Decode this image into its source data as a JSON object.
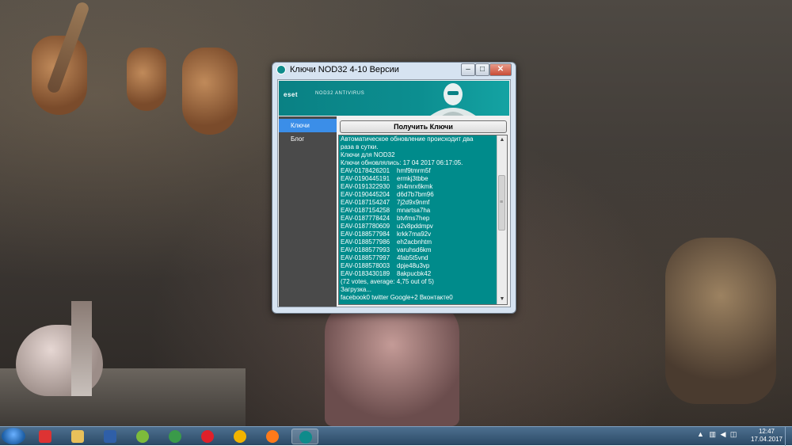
{
  "window": {
    "title": "Ключи NOD32 4-10 Версии",
    "controls": {
      "minimize": "–",
      "maximize": "□",
      "close": "✕"
    }
  },
  "banner": {
    "logo": "eset",
    "product": "NOD32 ANTIVIRUS"
  },
  "nav": {
    "items": [
      {
        "label": "Ключи",
        "active": true
      },
      {
        "label": "Блог",
        "active": false
      }
    ]
  },
  "main": {
    "get_keys_button": "Получить Ключи",
    "intro_lines": [
      "Автоматическое обновление происходит два",
      "раза в сутки.",
      "Ключи для NOD32",
      "Ключи обновлялись: 17 04 2017 06:17:05."
    ],
    "keys": [
      {
        "id": "EAV-0178426201",
        "value": "hmf9tmrm5f"
      },
      {
        "id": "EAV-0190445191",
        "value": "ermkj3tbbe"
      },
      {
        "id": "EAV-0191322930",
        "value": "sh4mrx6kmk"
      },
      {
        "id": "EAV-0190445204",
        "value": "d6d7b7bm96"
      },
      {
        "id": "EAV-0187154247",
        "value": "7j2d9x9nmf"
      },
      {
        "id": "EAV-0187154258",
        "value": "mnartsa7ha"
      },
      {
        "id": "EAV-0187778424",
        "value": "btvfms7hep"
      },
      {
        "id": "EAV-0187780609",
        "value": "u2v8pddmpv"
      },
      {
        "id": "EAV-0188577984",
        "value": "krkk7ma92v"
      },
      {
        "id": "EAV-0188577986",
        "value": "eh2acbnhtm"
      },
      {
        "id": "EAV-0188577993",
        "value": "varuhsd6km"
      },
      {
        "id": "EAV-0188577997",
        "value": "4fab5t5vnd"
      },
      {
        "id": "EAV-0188578003",
        "value": "dpje48u3vp"
      },
      {
        "id": "EAV-0183430189",
        "value": "8akpucbk42"
      }
    ],
    "footer_lines": [
      " (72 votes, average: 4,75 out of 5)",
      " Загрузка...",
      "facebook0 twitter Google+2 Вконтакте0"
    ]
  },
  "taskbar": {
    "apps": [
      "mail-icon",
      "explorer-icon",
      "virtualbox-icon",
      "green-app-icon",
      "globe-icon",
      "opera-icon",
      "chrome-icon",
      "firefox-icon",
      "nod32-app-icon"
    ],
    "clock_time": "12:47",
    "clock_date": "17.04.2017",
    "colors": {
      "accent": "#008b8b",
      "nav_active": "#3b8ee8"
    }
  }
}
